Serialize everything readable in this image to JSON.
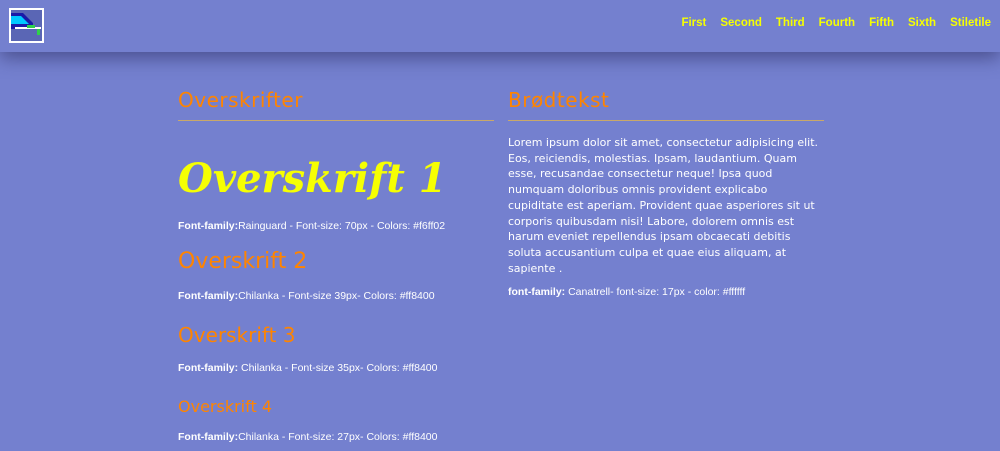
{
  "header": {
    "nav": [
      "First",
      "Second",
      "Third",
      "Fourth",
      "Fifth",
      "Sixth",
      "Stiletile"
    ]
  },
  "left": {
    "title": "Overskrifter",
    "h1": {
      "text": "Overskrift 1",
      "meta_label": "Font-family:",
      "meta_value": "Rainguard - Font-size: 70px - Colors: #f6ff02"
    },
    "h2": {
      "text": "Overskrift 2",
      "meta_label": "Font-family:",
      "meta_value": "Chilanka - Font-size 39px- Colors: #ff8400"
    },
    "h3": {
      "text": "Overskrift 3",
      "meta_label": "Font-family:",
      "meta_value": " Chilanka - Font-size 35px- Colors: #ff8400"
    },
    "h4": {
      "text": "Overskrift 4",
      "meta_label": "Font-family:",
      "meta_value": "Chilanka - Font-size: 27px- Colors: #ff8400"
    }
  },
  "right": {
    "title": "Brødtekst",
    "body": "Lorem ipsum dolor sit amet, consectetur adipisicing elit. Eos, reiciendis, molestias. Ipsam, laudantium. Quam esse, recusandae consectetur neque! Ipsa quod numquam doloribus omnis provident explicabo cupiditate est aperiam. Provident quae asperiores sit ut corporis quibusdam nisi! Labore, dolorem omnis est harum eveniet repellendus ipsam obcaecati debitis soluta accusantium culpa et quae eius aliquam, at sapiente .",
    "meta_label": "font-family:",
    "meta_value": " Canatrell- font-size: 17px - color: #ffffff"
  },
  "colors": {
    "background": "#7480cf",
    "heading_yellow": "#f6ff02",
    "heading_orange": "#ff8400",
    "body": "#ffffff"
  }
}
